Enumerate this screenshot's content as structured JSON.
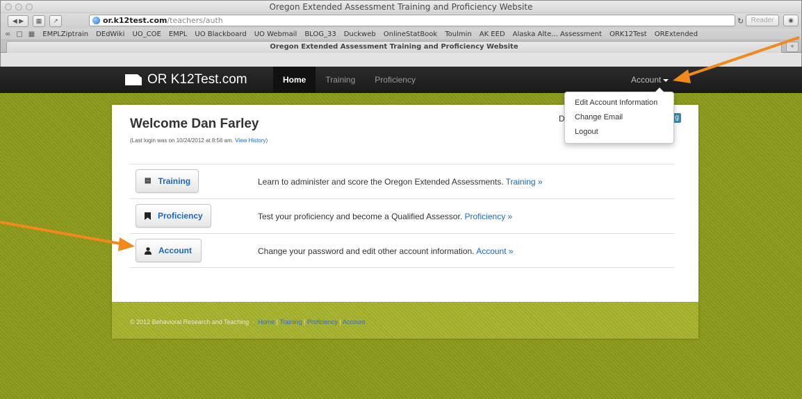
{
  "browser": {
    "window_title": "Oregon Extended Assessment Training and Proficiency Website",
    "url_host": "or.k12test.com",
    "url_path": "/teachers/auth",
    "reader_label": "Reader",
    "tab_title": "Oregon Extended Assessment Training and Proficiency Website",
    "bookmarks": [
      "EMPLZiptrain",
      "DEdWiki",
      "UO_COE",
      "EMPL",
      "UO Blackboard",
      "UO Webmail",
      "BLOG_33",
      "Duckweb",
      "OnlineStatBook",
      "Toulmin",
      "AK EED",
      "Alaska Alte... Assessment",
      "ORK12Test",
      "ORExtended"
    ]
  },
  "navbar": {
    "brand": "OR K12Test.com",
    "links": [
      "Home",
      "Training",
      "Proficiency"
    ],
    "account_label": "Account"
  },
  "dropdown": {
    "items": [
      "Edit Account Information",
      "Change Email",
      "Logout"
    ]
  },
  "main": {
    "welcome": "Welcome Dan Farley",
    "last_login_prefix": "(Last login was on 10/24/2012 at 8:56 am.",
    "view_history": "View History",
    "last_login_suffix": ")",
    "d_text": "D",
    "badge_text": "g",
    "rows": [
      {
        "button": "Training",
        "text": "Learn to administer and score the Oregon Extended Assessments.",
        "link": "Training »"
      },
      {
        "button": "Proficiency",
        "text": "Test your proficiency and become a Qualified Assessor.",
        "link": "Proficiency »"
      },
      {
        "button": "Account",
        "text": "Change your password and edit other account information.",
        "link": "Account »"
      }
    ]
  },
  "footer": {
    "copyright": "© 2012 Behavioral Research and Teaching",
    "sep": "·",
    "links": [
      "Home",
      "Training",
      "Proficiency",
      "Account"
    ],
    "divider": "|"
  },
  "colors": {
    "background_green": "#8b9a1a",
    "footer_green": "#a5b22b",
    "navbar_dark": "#1f1f1f",
    "link_blue": "#1a66c2",
    "annotation_arrow": "#f08a1c"
  }
}
